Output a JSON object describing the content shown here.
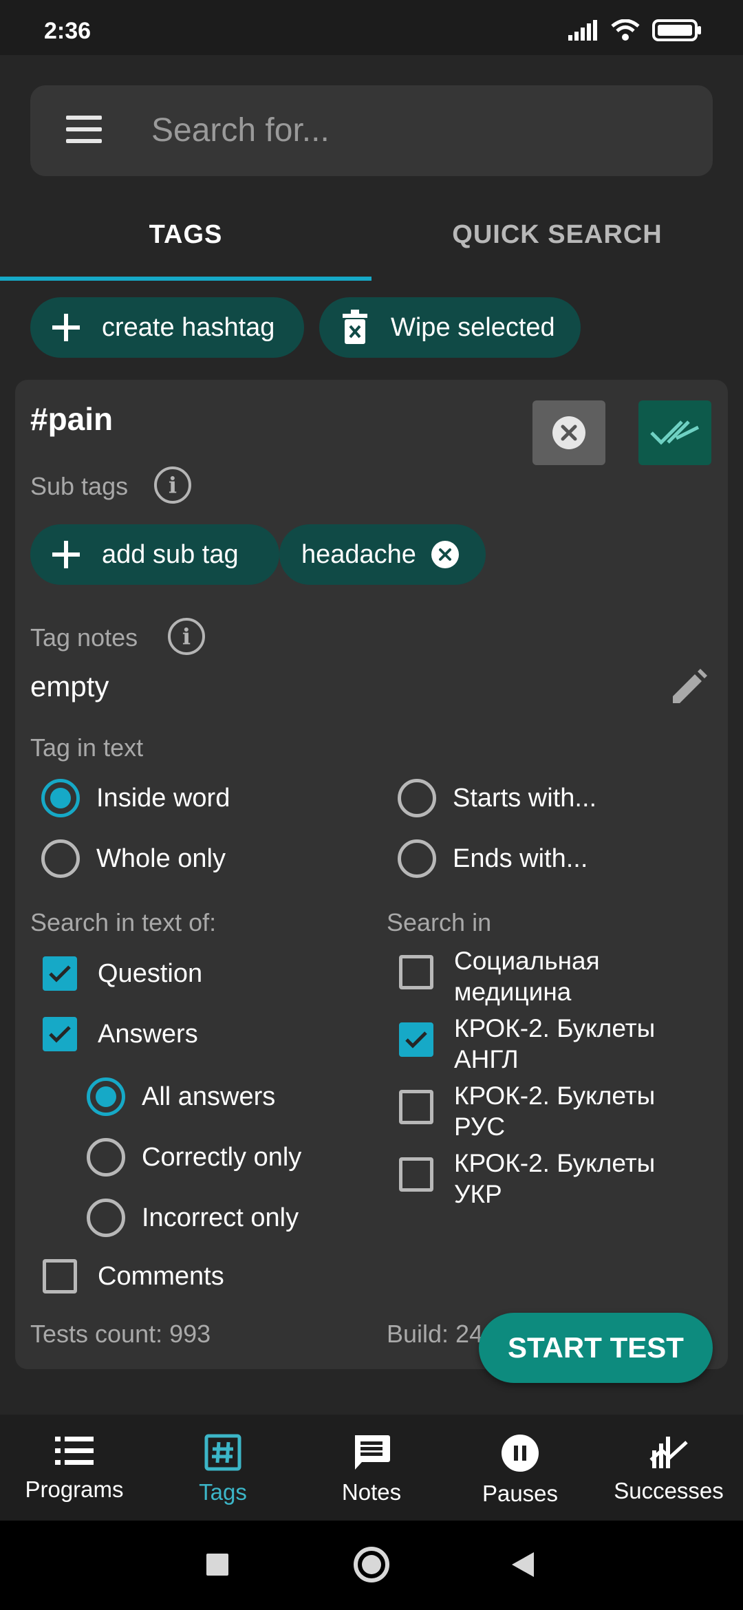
{
  "status_bar": {
    "time": "2:36"
  },
  "search": {
    "placeholder": "Search for..."
  },
  "tabs": [
    {
      "label": "TAGS"
    },
    {
      "label": "QUICK SEARCH"
    }
  ],
  "actions": {
    "create_hashtag": "create hashtag",
    "wipe_selected": "Wipe selected"
  },
  "tag": {
    "name": "#pain",
    "subtags_label": "Sub tags",
    "add_subtag": "add sub tag",
    "subtags": [
      "headache"
    ],
    "notes_label": "Tag notes",
    "notes_value": "empty",
    "tag_in_text_label": "Tag in text",
    "tag_in_text_options": [
      {
        "label": "Inside word",
        "selected": true
      },
      {
        "label": "Whole only",
        "selected": false
      },
      {
        "label": "Starts with...",
        "selected": false
      },
      {
        "label": "Ends with...",
        "selected": false
      }
    ],
    "search_text_label": "Search in text of:",
    "search_text": {
      "question": {
        "label": "Question",
        "checked": true
      },
      "answers": {
        "label": "Answers",
        "checked": true
      },
      "answer_modes": [
        {
          "label": "All answers",
          "selected": true
        },
        {
          "label": "Correctly only",
          "selected": false
        },
        {
          "label": "Incorrect only",
          "selected": false
        }
      ],
      "comments": {
        "label": "Comments",
        "checked": false
      }
    },
    "search_in_label": "Search in",
    "programs": [
      {
        "line1": "Социальная",
        "line2": "медицина",
        "checked": false
      },
      {
        "line1": "КРОК-2. Буклеты",
        "line2": "АНГЛ",
        "checked": true
      },
      {
        "line1": "КРОК-2. Буклеты",
        "line2": "РУС",
        "checked": false
      },
      {
        "line1": "КРОК-2. Буклеты",
        "line2": "УКР",
        "checked": false
      }
    ],
    "tests_count": "Tests count: 993",
    "build": "Build: 24"
  },
  "start_test": "START TEST",
  "bottom_nav": [
    {
      "label": "Programs",
      "icon": "list-icon"
    },
    {
      "label": "Tags",
      "icon": "hashtag-icon",
      "active": true
    },
    {
      "label": "Notes",
      "icon": "message-icon"
    },
    {
      "label": "Pauses",
      "icon": "pause-icon"
    },
    {
      "label": "Successes",
      "icon": "chart-icon"
    }
  ],
  "colors": {
    "accent": "#16a9c7",
    "chip": "#104a46",
    "fab": "#0d8b7e",
    "background": "#262626",
    "card": "#333333"
  }
}
